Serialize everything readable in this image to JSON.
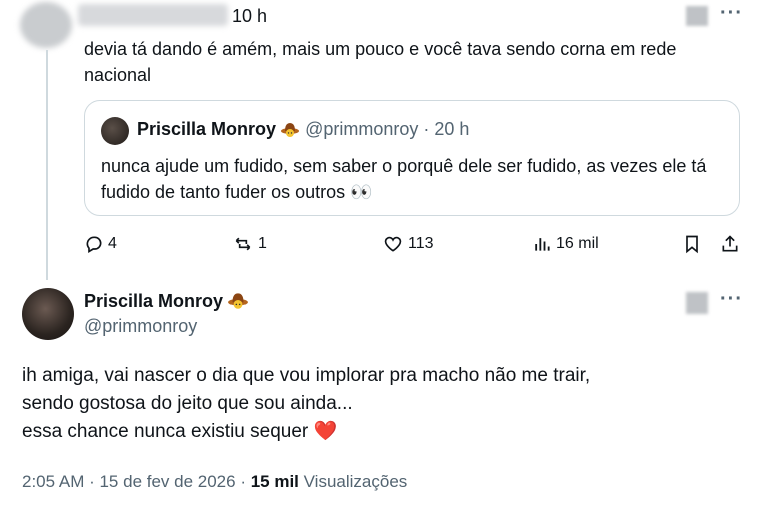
{
  "reply": {
    "time": "10 h",
    "text": "devia tá dando é amém, mais um pouco e você tava sendo corna em rede nacional"
  },
  "quote": {
    "name": "Priscilla Monroy",
    "handle_time": "@primmonroy · 20 h",
    "text": "nunca ajude um fudido, sem saber o porquê dele ser fudido, as vezes ele tá fudido de tanto fuder os outros 👀"
  },
  "actions": {
    "replies": "4",
    "reposts": "1",
    "likes": "113",
    "views": "16 mil"
  },
  "main": {
    "name": "Priscilla Monroy",
    "handle": "@primmonroy",
    "line1": "ih amiga, vai nascer o dia que vou implorar pra macho não me trair,",
    "line2": "sendo gostosa do jeito que sou ainda...",
    "line3": "essa chance nunca existiu sequer ❤️",
    "timestamp": "2:05 AM · 15 de fev de 2026 · ",
    "views_count": "15 mil",
    "views_label": "Visualizações"
  },
  "menu_icon": "more-dots-icon",
  "colors": {
    "text": "#0f1419",
    "secondary": "#536471",
    "border": "#cfd9de",
    "heart": "#e0162b"
  }
}
